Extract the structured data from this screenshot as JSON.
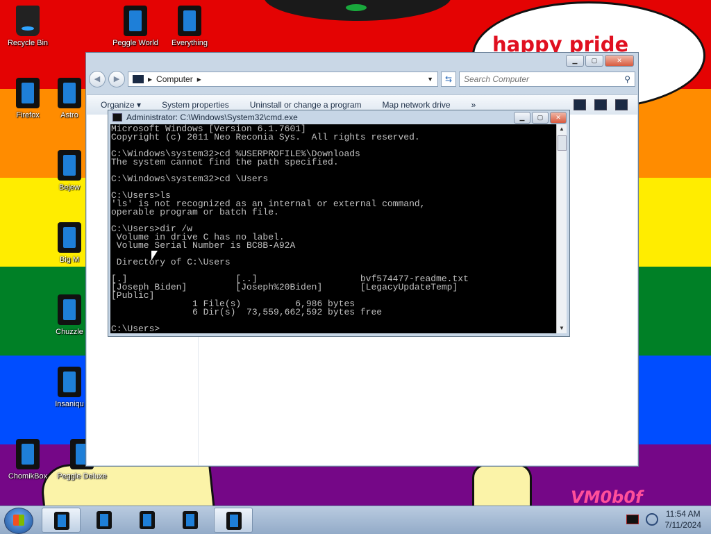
{
  "wallpaper": {
    "stripe_colors": [
      "#e40303",
      "#ff8c00",
      "#ffed00",
      "#008026",
      "#004dff",
      "#750787"
    ],
    "bubble_text": "happy pride month",
    "watermark": "VM0b0f"
  },
  "desktop_icons": [
    {
      "label": "Recycle Bin"
    },
    {
      "label": "Peggle World"
    },
    {
      "label": "Everything"
    },
    {
      "label": "Firefox"
    },
    {
      "label": "Astro"
    },
    {
      "label": "Bejew"
    },
    {
      "label": "Big M"
    },
    {
      "label": "Chuzzle"
    },
    {
      "label": "Insaniqu"
    },
    {
      "label": "ChomikBox"
    },
    {
      "label": "Peggle Deluxe"
    }
  ],
  "explorer": {
    "address": "Computer",
    "search_placeholder": "Search Computer",
    "toolbar": {
      "organize": "Organize ▾",
      "system_properties": "System properties",
      "uninstall": "Uninstall or change a program",
      "map_drive": "Map network drive",
      "more": "»"
    }
  },
  "cmd": {
    "title": "Administrator: C:\\Windows\\System32\\cmd.exe",
    "lines": [
      "Microsoft Windows [Version 6.1.7601]",
      "Copyright (c) 2011 Neo Reconia Sys.  All rights reserved.",
      "",
      "C:\\Windows\\system32>cd %USERPROFILE%\\Downloads",
      "The system cannot find the path specified.",
      "",
      "C:\\Windows\\system32>cd \\Users",
      "",
      "C:\\Users>ls",
      "'ls' is not recognized as an internal or external command,",
      "operable program or batch file.",
      "",
      "C:\\Users>dir /w",
      " Volume in drive C has no label.",
      " Volume Serial Number is BC8B-A92A",
      "",
      " Directory of C:\\Users",
      "",
      "[.]                    [..]                   bvf574477-readme.txt",
      "[Joseph Biden]         [Joseph%20Biden]       [LegacyUpdateTemp]",
      "[Public]",
      "               1 File(s)          6,986 bytes",
      "               6 Dir(s)  73,559,662,592 bytes free",
      "",
      "C:\\Users>"
    ]
  },
  "clock": {
    "time": "11:54 AM",
    "date": "7/11/2024"
  }
}
